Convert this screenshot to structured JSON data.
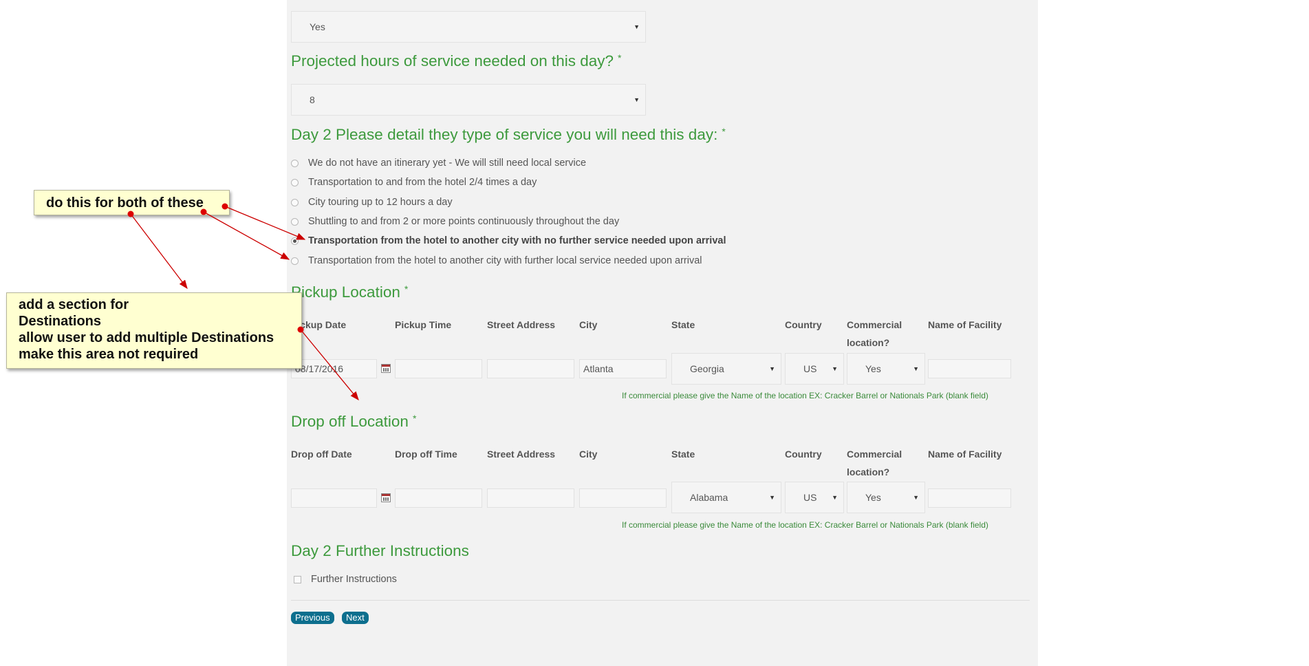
{
  "top_select": {
    "value": "Yes"
  },
  "hours": {
    "question": "Projected hours of service needed on this day?",
    "required": "*",
    "value": "8"
  },
  "service": {
    "question": "Day 2 Please detail they type of service you will need this day:",
    "required": "*",
    "options": [
      "We do not have an itinerary yet - We will still need local service",
      "Transportation to and from the hotel 2/4 times a day",
      "City touring up to 12 hours a day",
      "Shuttling to and from 2 or more points continuously throughout the day",
      "Transportation from the hotel to another city with no further service needed upon arrival",
      "Transportation from the hotel to another city with further local service needed upon arrival"
    ],
    "selected_index": 4
  },
  "pickup": {
    "title": "Pickup Location",
    "required": "*",
    "headers": [
      "Pickup Date",
      "Pickup Time",
      "Street Address",
      "City",
      "State",
      "Country",
      "Commercial",
      "location?",
      "Name of Facility"
    ],
    "date": "08/17/2016",
    "time": "",
    "street": "",
    "city": "Atlanta",
    "state": "Georgia",
    "country": "US",
    "commercial": "Yes",
    "facility": "",
    "hint": "If commercial please give the Name of the location EX: Cracker Barrel or Nationals Park (blank field)"
  },
  "dropoff": {
    "title": "Drop off Location",
    "required": "*",
    "headers": [
      "Drop off Date",
      "Drop off Time",
      "Street Address",
      "City",
      "State",
      "Country",
      "Commercial",
      "location?",
      "Name of Facility"
    ],
    "date": "",
    "time": "",
    "street": "",
    "city": "",
    "state": "Alabama",
    "country": "US",
    "commercial": "Yes",
    "facility": "",
    "hint": "If commercial please give the Name of the location EX: Cracker Barrel or Nationals Park (blank field)"
  },
  "further": {
    "title": "Day 2 Further Instructions",
    "checkbox_label": "Further Instructions"
  },
  "nav": {
    "previous": "Previous",
    "next": "Next"
  },
  "annotations": {
    "callout1": "do this for both of these",
    "callout2": [
      "add a section for",
      "Destinations",
      "allow user to add multiple Destinations",
      "make this area not required"
    ],
    "arrow_color": "#cc0000"
  },
  "colors": {
    "heading_green": "#3d9a3d",
    "button_blue": "#0d6f8e",
    "callout_bg": "#ffffd1"
  }
}
